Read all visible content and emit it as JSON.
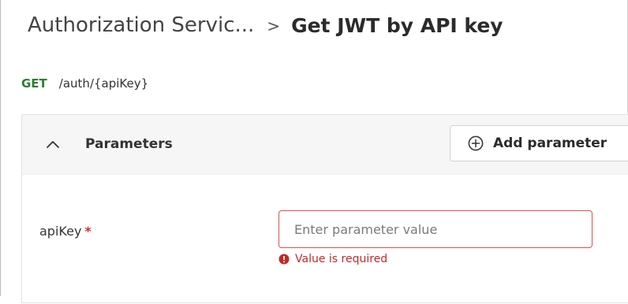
{
  "breadcrumb": {
    "parent": "Authorization Servic...",
    "separator": ">",
    "current": "Get JWT by API key"
  },
  "endpoint": {
    "method": "GET",
    "path": "/auth/{apiKey}"
  },
  "parameters_panel": {
    "title": "Parameters",
    "expanded": true,
    "add_button_label": "Add parameter",
    "params": [
      {
        "name": "apiKey",
        "required_marker": "*",
        "value": "",
        "placeholder": "Enter parameter value",
        "error": "Value is required"
      }
    ]
  },
  "icons": {
    "collapse": "chevron-up-icon",
    "add": "plus-circle-icon",
    "error": "error-circle-icon"
  },
  "colors": {
    "method_get": "#2e7d32",
    "error": "#c62828",
    "input_error_border": "#d9534f",
    "required": "#d32f2f"
  }
}
